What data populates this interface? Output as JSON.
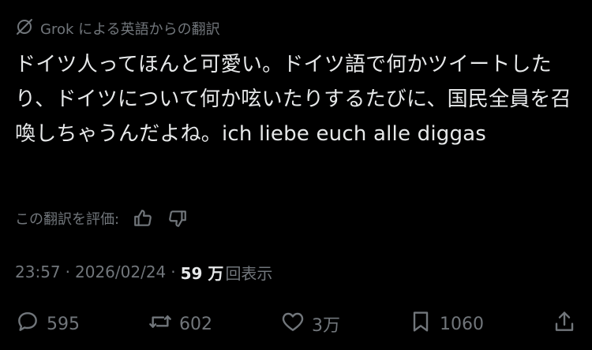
{
  "translation": {
    "label": "Grok による英語からの翻訳",
    "icon": "grok-icon"
  },
  "tweet": {
    "text": "ドイツ人ってほんと可愛い。ドイツ語で何かツイートしたり、ドイツについて何か呟いたりするたびに、国民全員を召喚しちゃうんだよね。ich liebe euch alle diggas"
  },
  "rating": {
    "label": "この翻訳を評価:",
    "like_icon": "thumbs-up-icon",
    "dislike_icon": "thumbs-down-icon"
  },
  "meta": {
    "time": "23:57",
    "separator": "·",
    "date": "2026/02/24",
    "views_count": "59 万",
    "views_label": "回表示"
  },
  "actions": {
    "replies": "595",
    "reposts": "602",
    "likes": "3万",
    "bookmarks": "1060"
  },
  "colors": {
    "background": "#000000",
    "text": "#e7e9ea",
    "secondary": "#71767b"
  }
}
